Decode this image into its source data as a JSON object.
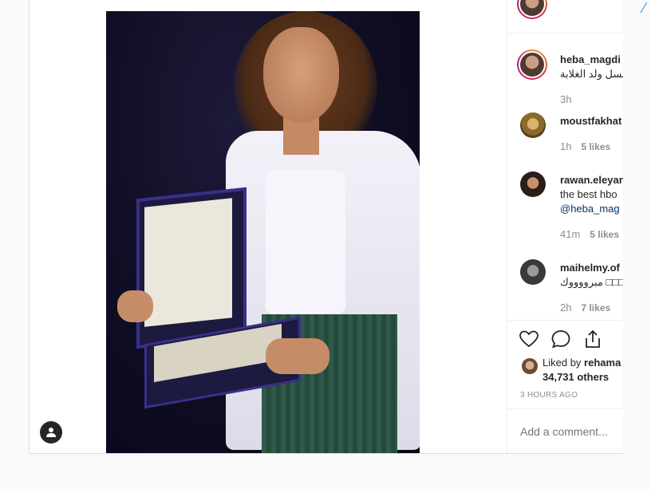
{
  "post": {
    "author": "heba_magdi",
    "caption": "مسلسل ولد الغلابة",
    "caption_time": "3h",
    "comments": [
      {
        "user": "moustfakhat",
        "text": "",
        "time": "1h",
        "likes": "5 likes"
      },
      {
        "user": "rawan.eleyar",
        "text": "the best hbo",
        "mention": "@heba_mag",
        "time": "41m",
        "likes": "5 likes"
      },
      {
        "user": "maihelmy.of",
        "text": "مبرووووك □□□",
        "time": "2h",
        "likes": "7 likes"
      }
    ],
    "liked_by_prefix": "Liked by ",
    "liked_by_user": "rehama",
    "liked_by_others": "34,731 others",
    "timestamp": "3 HOURS AGO",
    "add_comment_placeholder": "Add a comment..."
  },
  "icons": {
    "like": "heart-icon",
    "comment": "comment-icon",
    "share": "share-icon",
    "user_tag": "user-tag-icon"
  },
  "colors": {
    "brand_blue": "#3897f0",
    "mention": "#003569",
    "muted": "#8e8e8e",
    "text": "#262626"
  }
}
